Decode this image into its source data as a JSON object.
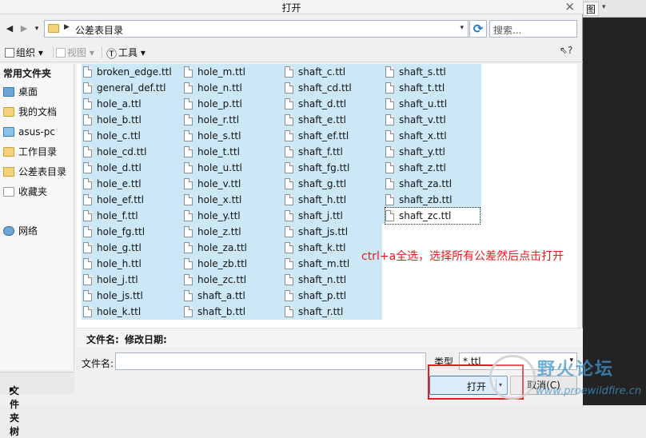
{
  "window": {
    "title": "打开",
    "close_glyph": "×"
  },
  "background_app": {
    "tab_label": "图",
    "arrow": "▾"
  },
  "nav": {
    "back": "◀",
    "forward": "▶",
    "history": "▾",
    "breadcrumb_sep": "▶",
    "path": "公差表目录",
    "path_dropdown": "▾",
    "refresh": "⟳",
    "search_placeholder": "搜索..."
  },
  "toolbar": {
    "organize": "组织",
    "views": "视图",
    "tools": "工具",
    "dropdown": "▾",
    "help": "⇖?"
  },
  "sidebar": {
    "header": "常用文件夹",
    "items": [
      {
        "label": "桌面",
        "icon": "desktop-icon"
      },
      {
        "label": "我的文档",
        "icon": "documents-icon"
      },
      {
        "label": "asus-pc",
        "icon": "computer-icon"
      },
      {
        "label": "工作目录",
        "icon": "working-directory-icon"
      },
      {
        "label": "公差表目录",
        "icon": "folder-icon"
      },
      {
        "label": "收藏夹",
        "icon": "favorites-icon"
      },
      {
        "label": "网络",
        "icon": "network-icon"
      }
    ],
    "folder_tree": "文件夹树",
    "folder_tree_toggle": "▸"
  },
  "files": {
    "columns": [
      [
        "broken_edge.ttl",
        "general_def.ttl",
        "hole_a.ttl",
        "hole_b.ttl",
        "hole_c.ttl",
        "hole_cd.ttl",
        "hole_d.ttl",
        "hole_e.ttl",
        "hole_ef.ttl",
        "hole_f.ttl",
        "hole_fg.ttl",
        "hole_g.ttl",
        "hole_h.ttl",
        "hole_j.ttl",
        "hole_js.ttl",
        "hole_k.ttl"
      ],
      [
        "hole_m.ttl",
        "hole_n.ttl",
        "hole_p.ttl",
        "hole_r.ttl",
        "hole_s.ttl",
        "hole_t.ttl",
        "hole_u.ttl",
        "hole_v.ttl",
        "hole_x.ttl",
        "hole_y.ttl",
        "hole_z.ttl",
        "hole_za.ttl",
        "hole_zb.ttl",
        "hole_zc.ttl",
        "shaft_a.ttl",
        "shaft_b.ttl"
      ],
      [
        "shaft_c.ttl",
        "shaft_cd.ttl",
        "shaft_d.ttl",
        "shaft_e.ttl",
        "shaft_ef.ttl",
        "shaft_f.ttl",
        "shaft_fg.ttl",
        "shaft_g.ttl",
        "shaft_h.ttl",
        "shaft_j.ttl",
        "shaft_js.ttl",
        "shaft_k.ttl",
        "shaft_m.ttl",
        "shaft_n.ttl",
        "shaft_p.ttl",
        "shaft_r.ttl"
      ],
      [
        "shaft_s.ttl",
        "shaft_t.ttl",
        "shaft_u.ttl",
        "shaft_v.ttl",
        "shaft_x.ttl",
        "shaft_y.ttl",
        "shaft_z.ttl",
        "shaft_za.ttl",
        "shaft_zb.ttl",
        "shaft_zc.ttl"
      ]
    ],
    "selection_state": "all selected",
    "focused_file": "shaft_zc.ttl"
  },
  "annotation": "ctrl+a全选，选择所有公差然后点击打开",
  "info": {
    "filename_label": "文件名:",
    "modified_label": "修改日期:"
  },
  "bottom": {
    "filename_label": "文件名:",
    "filename_value": "",
    "type_label": "类型",
    "type_value": "*.ttl",
    "open_label": "打开",
    "open_dropdown": "▾",
    "cancel_label": "取消(C)"
  },
  "watermark": {
    "title": "野火论坛",
    "url": "www.proewildfire.cn"
  },
  "colors": {
    "selection": "#cce8f6",
    "annotation": "#e01c1c",
    "highlight_box": "#e02020"
  }
}
